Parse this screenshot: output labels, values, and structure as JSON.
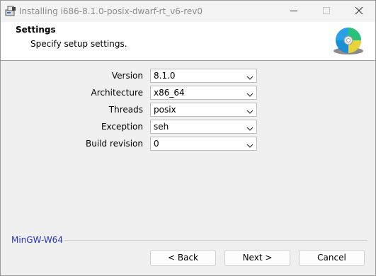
{
  "window": {
    "title": "Installing i686-8.1.0-posix-dwarf-rt_v6-rev0",
    "icons": {
      "app": "installer-icon",
      "minimize": "minimize-icon",
      "maximize": "maximize-icon",
      "close": "close-icon"
    }
  },
  "header": {
    "title": "Settings",
    "subtitle": "Specify setup settings.",
    "icon": "cd-disc-icon"
  },
  "form": {
    "fields": [
      {
        "label": "Version",
        "value": "8.1.0"
      },
      {
        "label": "Architecture",
        "value": "x86_64"
      },
      {
        "label": "Threads",
        "value": "posix"
      },
      {
        "label": "Exception",
        "value": "seh"
      },
      {
        "label": "Build revision",
        "value": "0"
      }
    ]
  },
  "footer": {
    "brand": "MinGW-W64",
    "back_label": "< Back",
    "next_label": "Next >",
    "cancel_label": "Cancel"
  },
  "colors": {
    "brand_link": "#2233c4",
    "title_text": "#8c8c8c",
    "header_bg": "#ffffff",
    "window_bg": "#f0f0f0"
  }
}
